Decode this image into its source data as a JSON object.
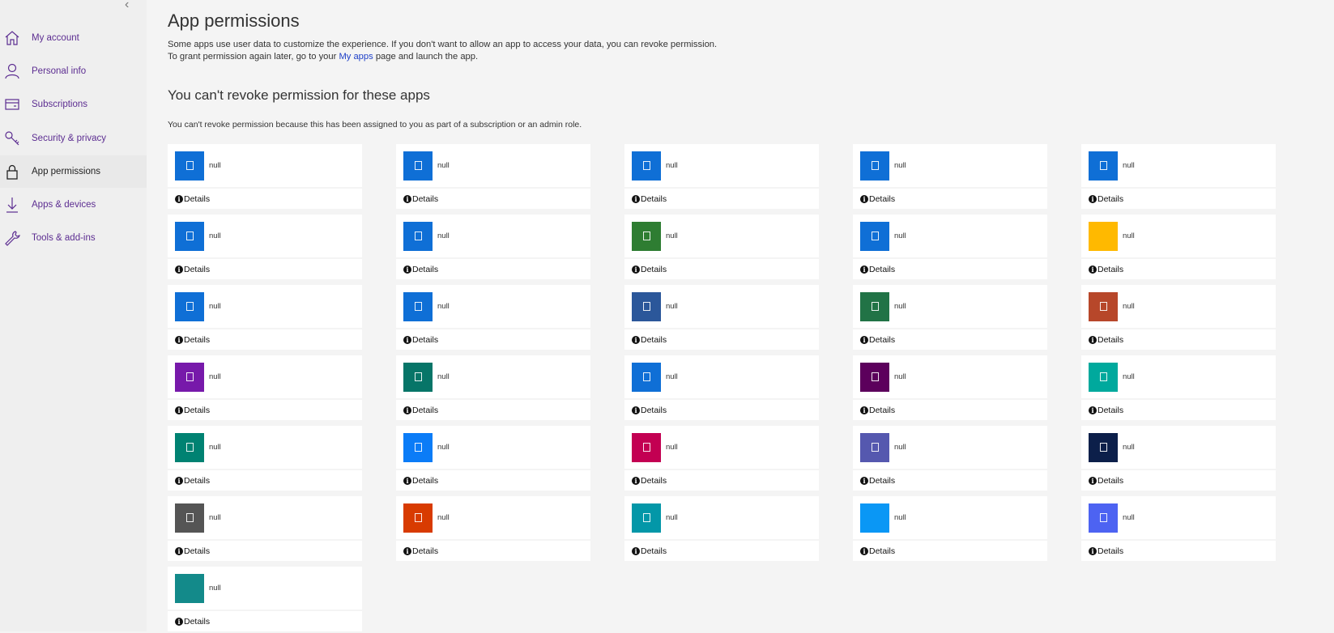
{
  "sidebar": {
    "items": [
      {
        "label": "My account",
        "icon": "home-icon",
        "selected": false
      },
      {
        "label": "Personal info",
        "icon": "person-icon",
        "selected": false
      },
      {
        "label": "Subscriptions",
        "icon": "card-icon",
        "selected": false
      },
      {
        "label": "Security & privacy",
        "icon": "key-icon",
        "selected": false
      },
      {
        "label": "App permissions",
        "icon": "lock-icon",
        "selected": true
      },
      {
        "label": "Apps & devices",
        "icon": "download-icon",
        "selected": false
      },
      {
        "label": "Tools & add-ins",
        "icon": "wrench-icon",
        "selected": false
      }
    ]
  },
  "main": {
    "title": "App permissions",
    "intro_line1": "Some apps use user data to customize the experience. If you don't want to allow an app to access your data, you can revoke permission.",
    "intro_line2_pre": "To grant permission again later, go to your ",
    "intro_link": "My apps",
    "intro_line2_post": " page and launch the app.",
    "section_title": "You can't revoke permission for these apps",
    "section_desc": "You can't revoke permission because this has been assigned to you as part of a subscription or an admin role.",
    "details_label": "Details",
    "apps": [
      {
        "name": "null",
        "color": "#0f6fd6",
        "glyph": true
      },
      {
        "name": "null",
        "color": "#0f6fd6",
        "glyph": true
      },
      {
        "name": "null",
        "color": "#0f6fd6",
        "glyph": true
      },
      {
        "name": "null",
        "color": "#0f6fd6",
        "glyph": true
      },
      {
        "name": "null",
        "color": "#0f6fd6",
        "glyph": true
      },
      {
        "name": "null",
        "color": "#0f6fd6",
        "glyph": true
      },
      {
        "name": "null",
        "color": "#0f6fd6",
        "glyph": true
      },
      {
        "name": "null",
        "color": "#2e7d32",
        "glyph": true
      },
      {
        "name": "null",
        "color": "#0f6fd6",
        "glyph": true
      },
      {
        "name": "null",
        "color": "#ffb900",
        "glyph": false
      },
      {
        "name": "null",
        "color": "#0f6fd6",
        "glyph": true
      },
      {
        "name": "null",
        "color": "#0f6fd6",
        "glyph": true
      },
      {
        "name": "null",
        "color": "#2b579a",
        "glyph": true
      },
      {
        "name": "null",
        "color": "#217346",
        "glyph": true
      },
      {
        "name": "null",
        "color": "#b7472a",
        "glyph": true
      },
      {
        "name": "null",
        "color": "#7719aa",
        "glyph": true
      },
      {
        "name": "null",
        "color": "#077568",
        "glyph": true
      },
      {
        "name": "null",
        "color": "#0f6fd6",
        "glyph": true
      },
      {
        "name": "null",
        "color": "#5c005c",
        "glyph": true
      },
      {
        "name": "null",
        "color": "#00a99d",
        "glyph": true
      },
      {
        "name": "null",
        "color": "#008272",
        "glyph": true
      },
      {
        "name": "null",
        "color": "#0b7cf7",
        "glyph": true
      },
      {
        "name": "null",
        "color": "#c30052",
        "glyph": true
      },
      {
        "name": "null",
        "color": "#5558af",
        "glyph": true
      },
      {
        "name": "null",
        "color": "#0c1f4a",
        "glyph": true
      },
      {
        "name": "null",
        "color": "#555555",
        "glyph": true
      },
      {
        "name": "null",
        "color": "#d83b01",
        "glyph": true
      },
      {
        "name": "null",
        "color": "#0397a8",
        "glyph": true
      },
      {
        "name": "null",
        "color": "#0a97f5",
        "glyph": false
      },
      {
        "name": "null",
        "color": "#4d63f2",
        "glyph": true
      },
      {
        "name": "null",
        "color": "#138a8a",
        "glyph": false
      }
    ]
  }
}
